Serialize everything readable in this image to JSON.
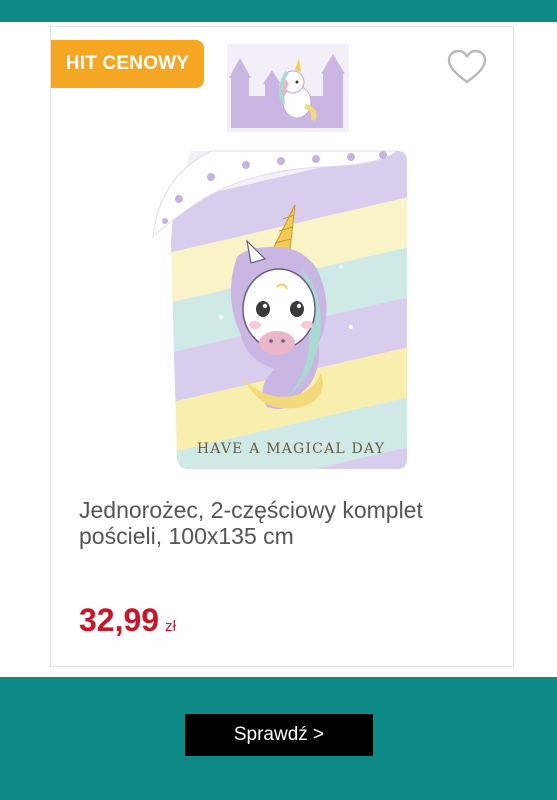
{
  "product": {
    "badge": "HIT CENOWY",
    "title": "Jednorożec, 2-częściowy komplet pościeli, 100x135 cm",
    "price": "32,99",
    "currency": "zł",
    "print_text": "HAVE A MAGICAL DAY"
  },
  "cta": {
    "label": "Sprawdź >"
  },
  "colors": {
    "banner": "#0e8a86",
    "badge": "#f5a623",
    "price": "#cc1427",
    "button": "#000000"
  },
  "icons": {
    "favorite": "heart-outline-icon"
  }
}
